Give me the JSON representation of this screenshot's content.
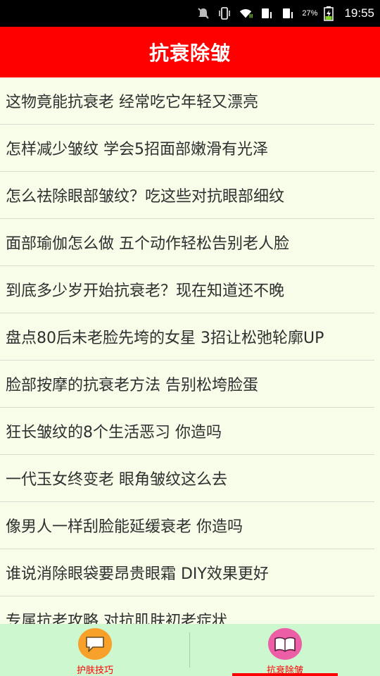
{
  "status_bar": {
    "battery_percent": "27%",
    "time": "19:55",
    "icons": [
      "mute-icon",
      "vibrate-icon",
      "wifi-icon",
      "sim1-icon",
      "sim2-icon",
      "battery-charging-icon"
    ]
  },
  "header": {
    "title": "抗衰除皱"
  },
  "articles": [
    "这物竟能抗衰老 经常吃它年轻又漂亮",
    "怎样减少皱纹 学会5招面部嫩滑有光泽",
    "怎么祛除眼部皱纹？吃这些对抗眼部细纹",
    "面部瑜伽怎么做 五个动作轻松告别老人脸",
    "到底多少岁开始抗衰老？现在知道还不晚",
    "盘点80后未老脸先垮的女星 3招让松弛轮廓UP",
    "脸部按摩的抗衰老方法 告别松垮脸蛋",
    "狂长皱纹的8个生活恶习 你造吗",
    "一代玉女终变老 眼角皱纹这么去",
    "像男人一样刮脸能延缓衰老 你造吗",
    "谁说消除眼袋要昂贵眼霜 DIY效果更好",
    "专属抗老攻略 对抗肌肤初老症状"
  ],
  "tabs": [
    {
      "label": "护肤技巧",
      "icon": "chat-bubble-icon",
      "color": "#f7a12a"
    },
    {
      "label": "抗衰除皱",
      "icon": "book-icon",
      "color": "#ec5fa6",
      "active": true
    }
  ],
  "colors": {
    "accent": "#ff0000",
    "background": "#f7fde9",
    "tab_bar": "#cdf7cf"
  }
}
